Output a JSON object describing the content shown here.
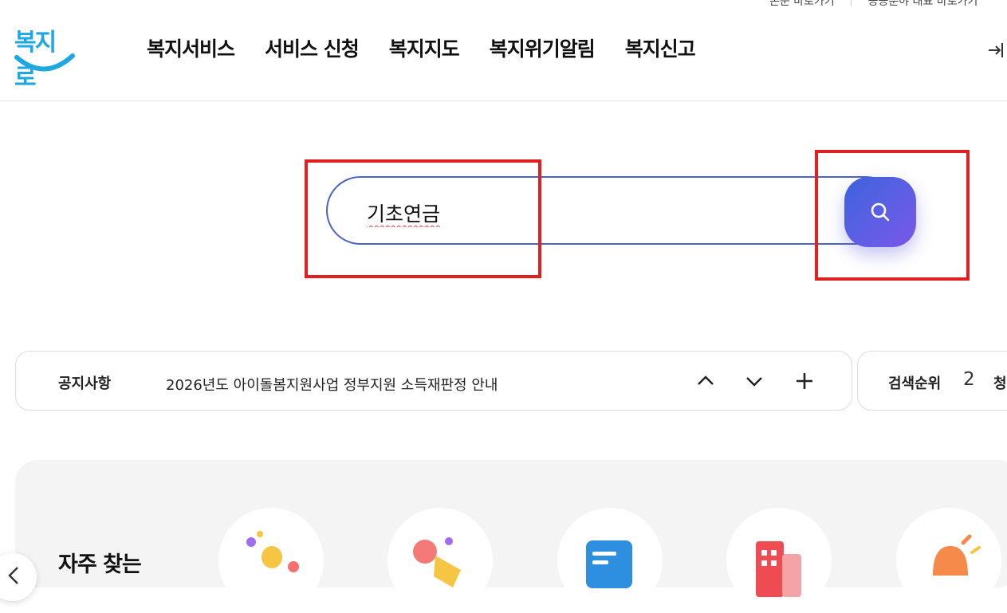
{
  "util_links": [
    "본문 바로가기",
    "공공분야 대표 바로가기"
  ],
  "logo": {
    "text": "복지로"
  },
  "gnb": [
    "복지서비스",
    "서비스 신청",
    "복지지도",
    "복지위기알림",
    "복지신고"
  ],
  "search": {
    "value": "기초연금"
  },
  "notice": {
    "label": "공지사항",
    "text": "2026년도 아이돌봄지원사업 정부지원 소득재판정 안내"
  },
  "rank": {
    "label": "검색순위",
    "number": "2",
    "term": "청"
  },
  "frequent": {
    "title": "자주 찾는",
    "icons": [
      "lightbulb-icon",
      "hand-pointer-icon",
      "document-list-icon",
      "building-icon",
      "alarm-siren-icon"
    ]
  },
  "colors": {
    "accent": "#4a62c9",
    "highlight": "#e02020",
    "logo": "#1ea7e1"
  }
}
